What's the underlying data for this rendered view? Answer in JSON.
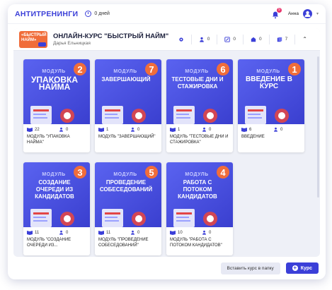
{
  "topbar": {
    "brand": "АНТИТРЕНИНГИ",
    "days": "0 дней",
    "notif_count": "9",
    "user": "Анна"
  },
  "course": {
    "thumb_text": "«БЫСТРЫЙ НАЙМ»",
    "title": "ОНЛАЙН-КУРС \"БЫСТРЫЙ НАЙМ\"",
    "author": "Дарья Ельницкая",
    "stats": {
      "users": "0",
      "tasks": "0",
      "homework": "0",
      "modules": "7"
    }
  },
  "cards": [
    {
      "num": "2",
      "module": "МОДУЛЬ",
      "title": "УПАКОВКА НАЙМА",
      "lessons": "22",
      "users": "0",
      "name": "МОДУЛЬ \"УПАКОВКА НАЙМА\""
    },
    {
      "num": "7",
      "module": "МОДУЛЬ",
      "title": "ЗАВЕРШАЮЩИЙ",
      "lessons": "1",
      "users": "0",
      "name": "МОДУЛЬ \"ЗАВЕРШАЮЩИЙ\""
    },
    {
      "num": "6",
      "module": "МОДУЛЬ",
      "title": "ТЕСТОВЫЕ ДНИ И СТАЖИРОВКА",
      "lessons": "1",
      "users": "0",
      "name": "МОДУЛЬ \"ТЕСТОВЫЕ ДНИ И СТАЖИРОВКА\""
    },
    {
      "num": "1",
      "module": "МОДУЛЬ",
      "title": "ВВЕДЕНИЕ В КУРС",
      "lessons": "6",
      "users": "0",
      "name": "ВВЕДЕНИЕ"
    },
    {
      "num": "3",
      "module": "МОДУЛЬ",
      "title": "СОЗДАНИЕ ОЧЕРЕДИ ИЗ КАНДИДАТОВ",
      "lessons": "11",
      "users": "0",
      "name": "МОДУЛЬ \"СОЗДАНИЕ ОЧЕРЕДИ ИЗ..."
    },
    {
      "num": "5",
      "module": "МОДУЛЬ",
      "title": "ПРОВЕДЕНИЕ СОБЕСЕДОВАНИЙ",
      "lessons": "11",
      "users": "0",
      "name": "МОДУЛЬ \"ПРОВЕДЕНИЕ СОБЕСЕДОВАНИЙ\""
    },
    {
      "num": "4",
      "module": "МОДУЛЬ",
      "title": "РАБОТА С ПОТОКОМ КАНДИДАТОВ",
      "lessons": "10",
      "users": "0",
      "name": "МОДУЛЬ \"РАБОТА С ПОТОКОМ КАНДИДАТОВ\""
    }
  ],
  "footer": {
    "add_to_folder": "Вставить курс в папку",
    "course_btn": "Курс"
  },
  "colors": {
    "accent": "#3b3fd8",
    "orange": "#f06d3a"
  }
}
